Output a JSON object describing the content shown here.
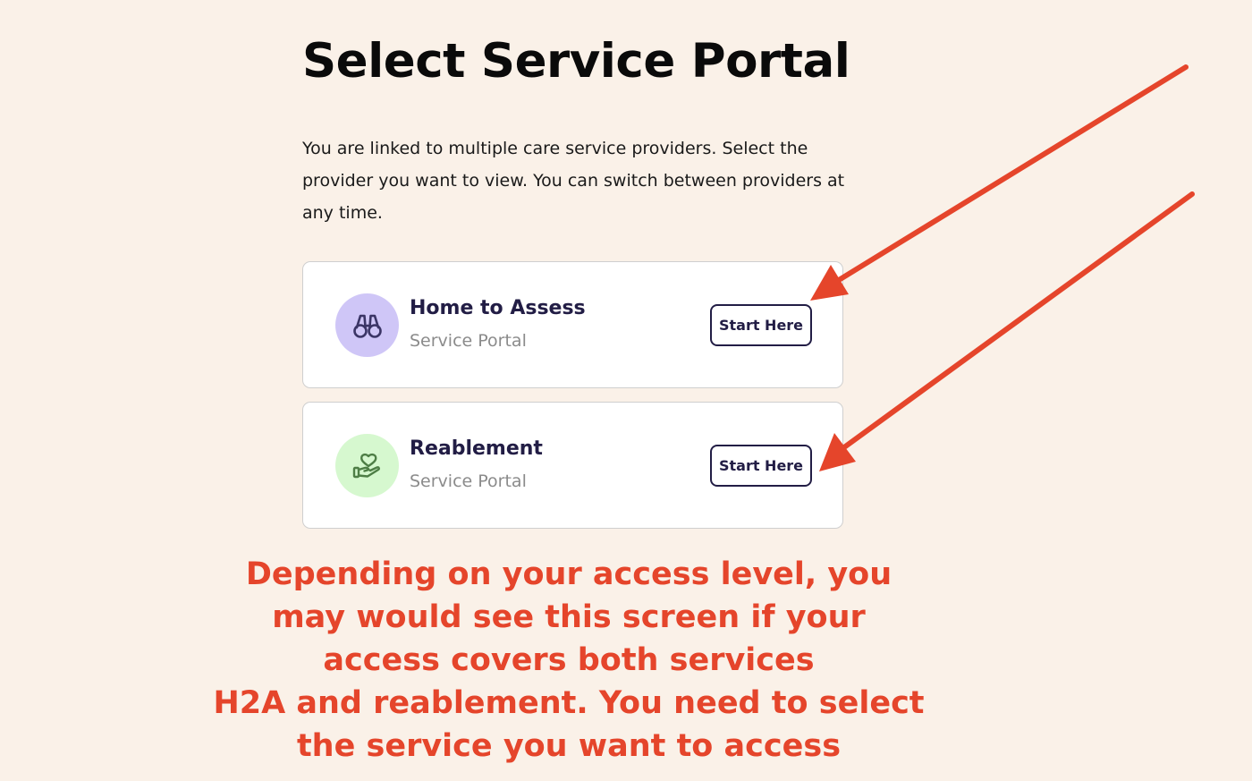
{
  "page": {
    "title": "Select Service Portal",
    "intro": "You are linked to multiple care service providers. Select the provider you want to view. You can switch between providers at any time."
  },
  "portals": [
    {
      "name": "Home to Assess",
      "subtitle": "Service Portal",
      "button_label": "Start Here",
      "icon": "binoculars-icon",
      "icon_bg": "#cfc6f7"
    },
    {
      "name": "Reablement",
      "subtitle": "Service Portal",
      "button_label": "Start Here",
      "icon": "hand-heart-icon",
      "icon_bg": "#d6f8cf"
    }
  ],
  "annotation": {
    "lines": [
      "Depending on your access level, you",
      "may would see this screen if your",
      "access covers both services",
      "H2A and reablement. You need to select",
      "the service you want to access"
    ],
    "color": "#e5452b"
  },
  "colors": {
    "background": "#faf1e8",
    "primary": "#221d45",
    "annotation": "#e5452b"
  }
}
